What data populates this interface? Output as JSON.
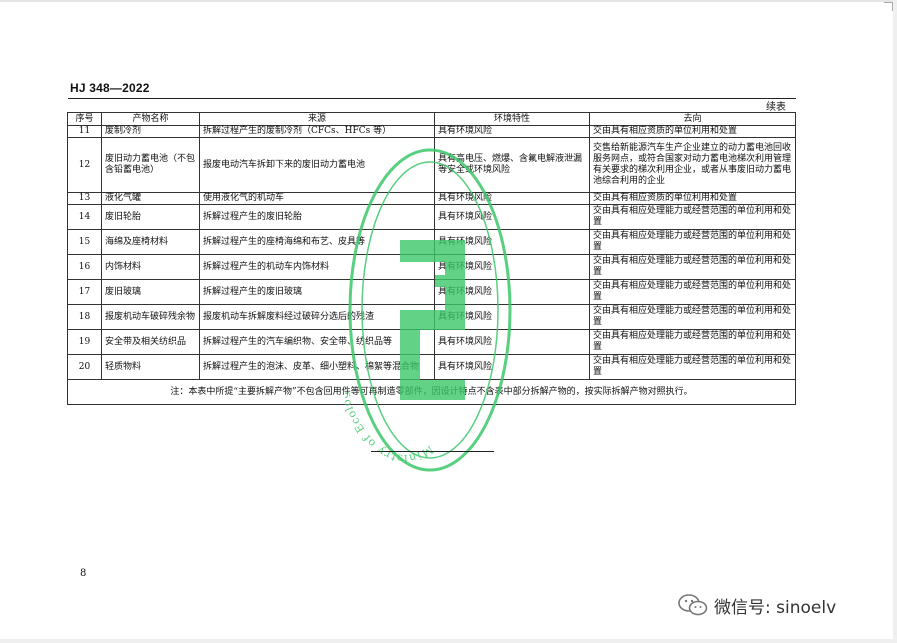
{
  "header": {
    "standard_code": "HJ 348—2022",
    "continued_label": "续表"
  },
  "table": {
    "columns": [
      "序号",
      "产物名称",
      "来源",
      "环境特性",
      "去向"
    ],
    "rows": [
      {
        "no": "11",
        "name": "废制冷剂",
        "source": "拆解过程产生的废制冷剂（CFCs、HFCs 等）",
        "env": "具有环境风险",
        "dest": "交由具有相应资质的单位利用和处置"
      },
      {
        "no": "12",
        "name": "废旧动力蓄电池（不包含铅蓄电池）",
        "source": "报废电动汽车拆卸下来的废旧动力蓄电池",
        "env": "具有高电压、燃爆、含氟电解液泄漏等安全或环境风险",
        "dest": "交售给新能源汽车生产企业建立的动力蓄电池回收服务网点，或符合国家对动力蓄电池梯次利用管理有关要求的梯次利用企业，或者从事废旧动力蓄电池综合利用的企业"
      },
      {
        "no": "13",
        "name": "液化气罐",
        "source": "使用液化气的机动车",
        "env": "具有环境风险",
        "dest": "交由具有相应资质的单位利用和处置"
      },
      {
        "no": "14",
        "name": "废旧轮胎",
        "source": "拆解过程产生的废旧轮胎",
        "env": "具有环境风险",
        "dest": "交由具有相应处理能力或经营范围的单位利用和处置"
      },
      {
        "no": "15",
        "name": "海绵及座椅材料",
        "source": "拆解过程产生的座椅海绵和布艺、皮具等",
        "env": "具有环境风险",
        "dest": "交由具有相应处理能力或经营范围的单位利用和处置"
      },
      {
        "no": "16",
        "name": "内饰材料",
        "source": "拆解过程产生的机动车内饰材料",
        "env": "具有环境风险",
        "dest": "交由具有相应处理能力或经营范围的单位利用和处置"
      },
      {
        "no": "17",
        "name": "废旧玻璃",
        "source": "拆解过程产生的废旧玻璃",
        "env": "具有环境风险",
        "dest": "交由具有相应处理能力或经营范围的单位利用和处置"
      },
      {
        "no": "18",
        "name": "报废机动车破碎残余物",
        "source": "报废机动车拆解废料经过破碎分选后的残渣",
        "env": "具有环境风险",
        "dest": "交由具有相应处理能力或经营范围的单位利用和处置"
      },
      {
        "no": "19",
        "name": "安全带及相关纺织品",
        "source": "拆解过程产生的汽车编织物、安全带、纺织品等",
        "env": "具有环境风险",
        "dest": "交由具有相应处理能力或经营范围的单位利用和处置"
      },
      {
        "no": "20",
        "name": "轻质物料",
        "source": "拆解过程产生的泡沫、皮革、细小塑料、棉絮等混合物",
        "env": "具有环境风险",
        "dest": "交由具有相应处理能力或经营范围的单位利用和处置"
      }
    ],
    "note": "注：本表中所提“主要拆解产物”不包含回用件等可再制造零部件，因设计特点不含表中部分拆解产物的，按实际拆解产物对照执行。"
  },
  "seal": {
    "text": "Ministry of Ecology and Environment",
    "color": "#3cc76a"
  },
  "footer": {
    "page_number": "8"
  },
  "watermark": {
    "text": "微信号: sinoelv"
  }
}
